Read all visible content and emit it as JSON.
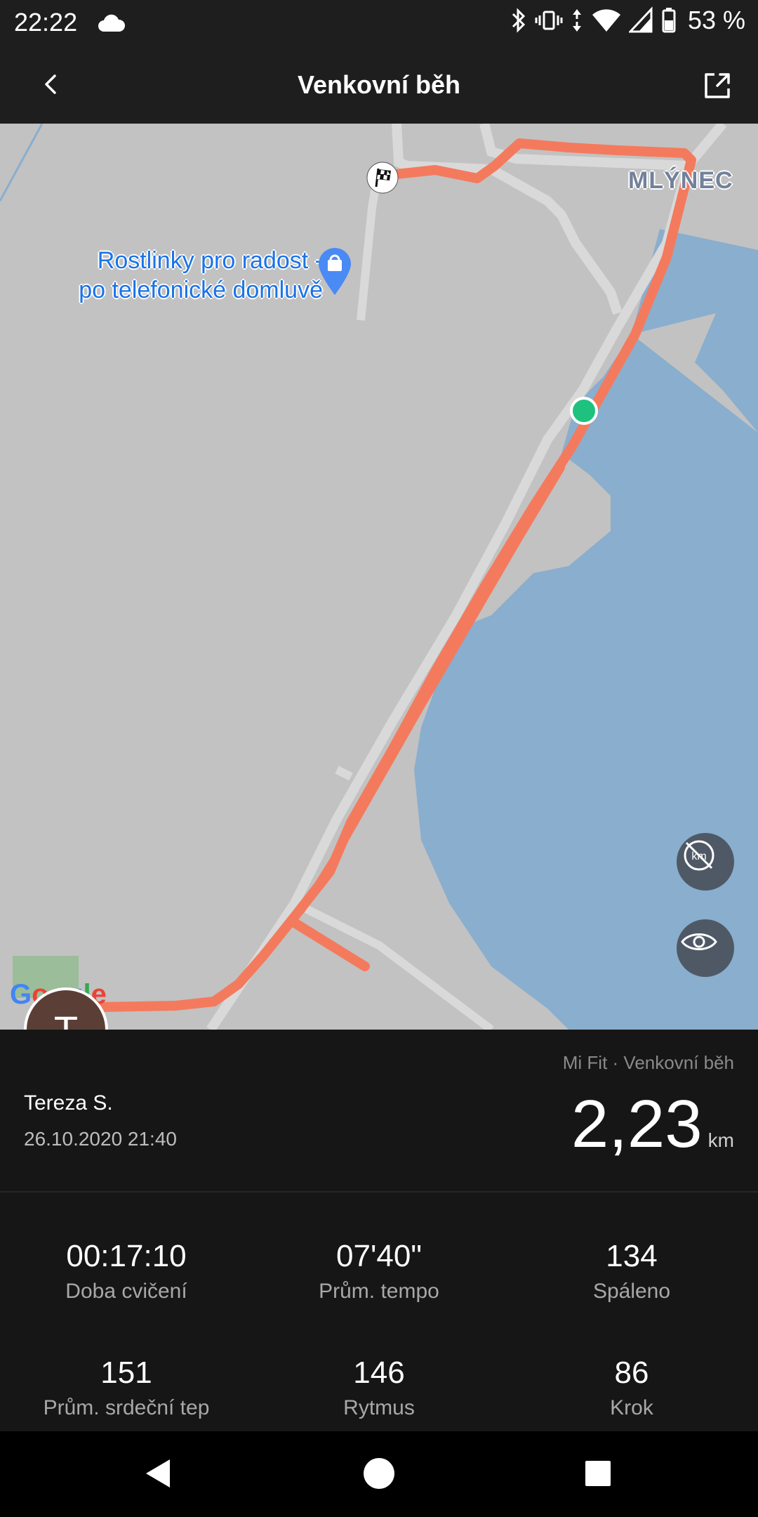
{
  "status_bar": {
    "time": "22:22",
    "battery": "53 %",
    "icons": [
      "cloud-icon",
      "bluetooth-icon",
      "vibrate-icon",
      "data-arrows-icon",
      "wifi-icon",
      "signal-icon",
      "battery-icon"
    ]
  },
  "header": {
    "title": "Venkovní běh",
    "back_icon": "chevron-left-icon",
    "share_icon": "share-icon"
  },
  "map": {
    "place_label": "MLÝNEC",
    "poi_label_line1": "Rostlinky pro radost -",
    "poi_label_line2": "po telefonické domluvě",
    "google": "Google",
    "route_color": "#f47a5e",
    "water_color": "#8aaecd",
    "land_color": "#c2c2c2",
    "current_point_color": "#1fc17f",
    "buttons": [
      "hide-km-icon",
      "eye-icon"
    ]
  },
  "user": {
    "initial": "T",
    "name": "Tereza S.",
    "date": "26.10.2020 21:40"
  },
  "summary": {
    "source": "Mi Fit · Venkovní běh",
    "distance": "2,23",
    "unit": "km"
  },
  "stats": [
    {
      "value": "00:17:10",
      "label": "Doba cvičení"
    },
    {
      "value": "07'40\"",
      "label": "Prům. tempo"
    },
    {
      "value": "134",
      "label": "Spáleno"
    },
    {
      "value": "151",
      "label": "Prům. srdeční tep"
    },
    {
      "value": "146",
      "label": "Rytmus"
    },
    {
      "value": "86",
      "label": "Krok"
    }
  ],
  "nav": [
    "back-triangle-icon",
    "home-circle-icon",
    "recents-square-icon"
  ]
}
